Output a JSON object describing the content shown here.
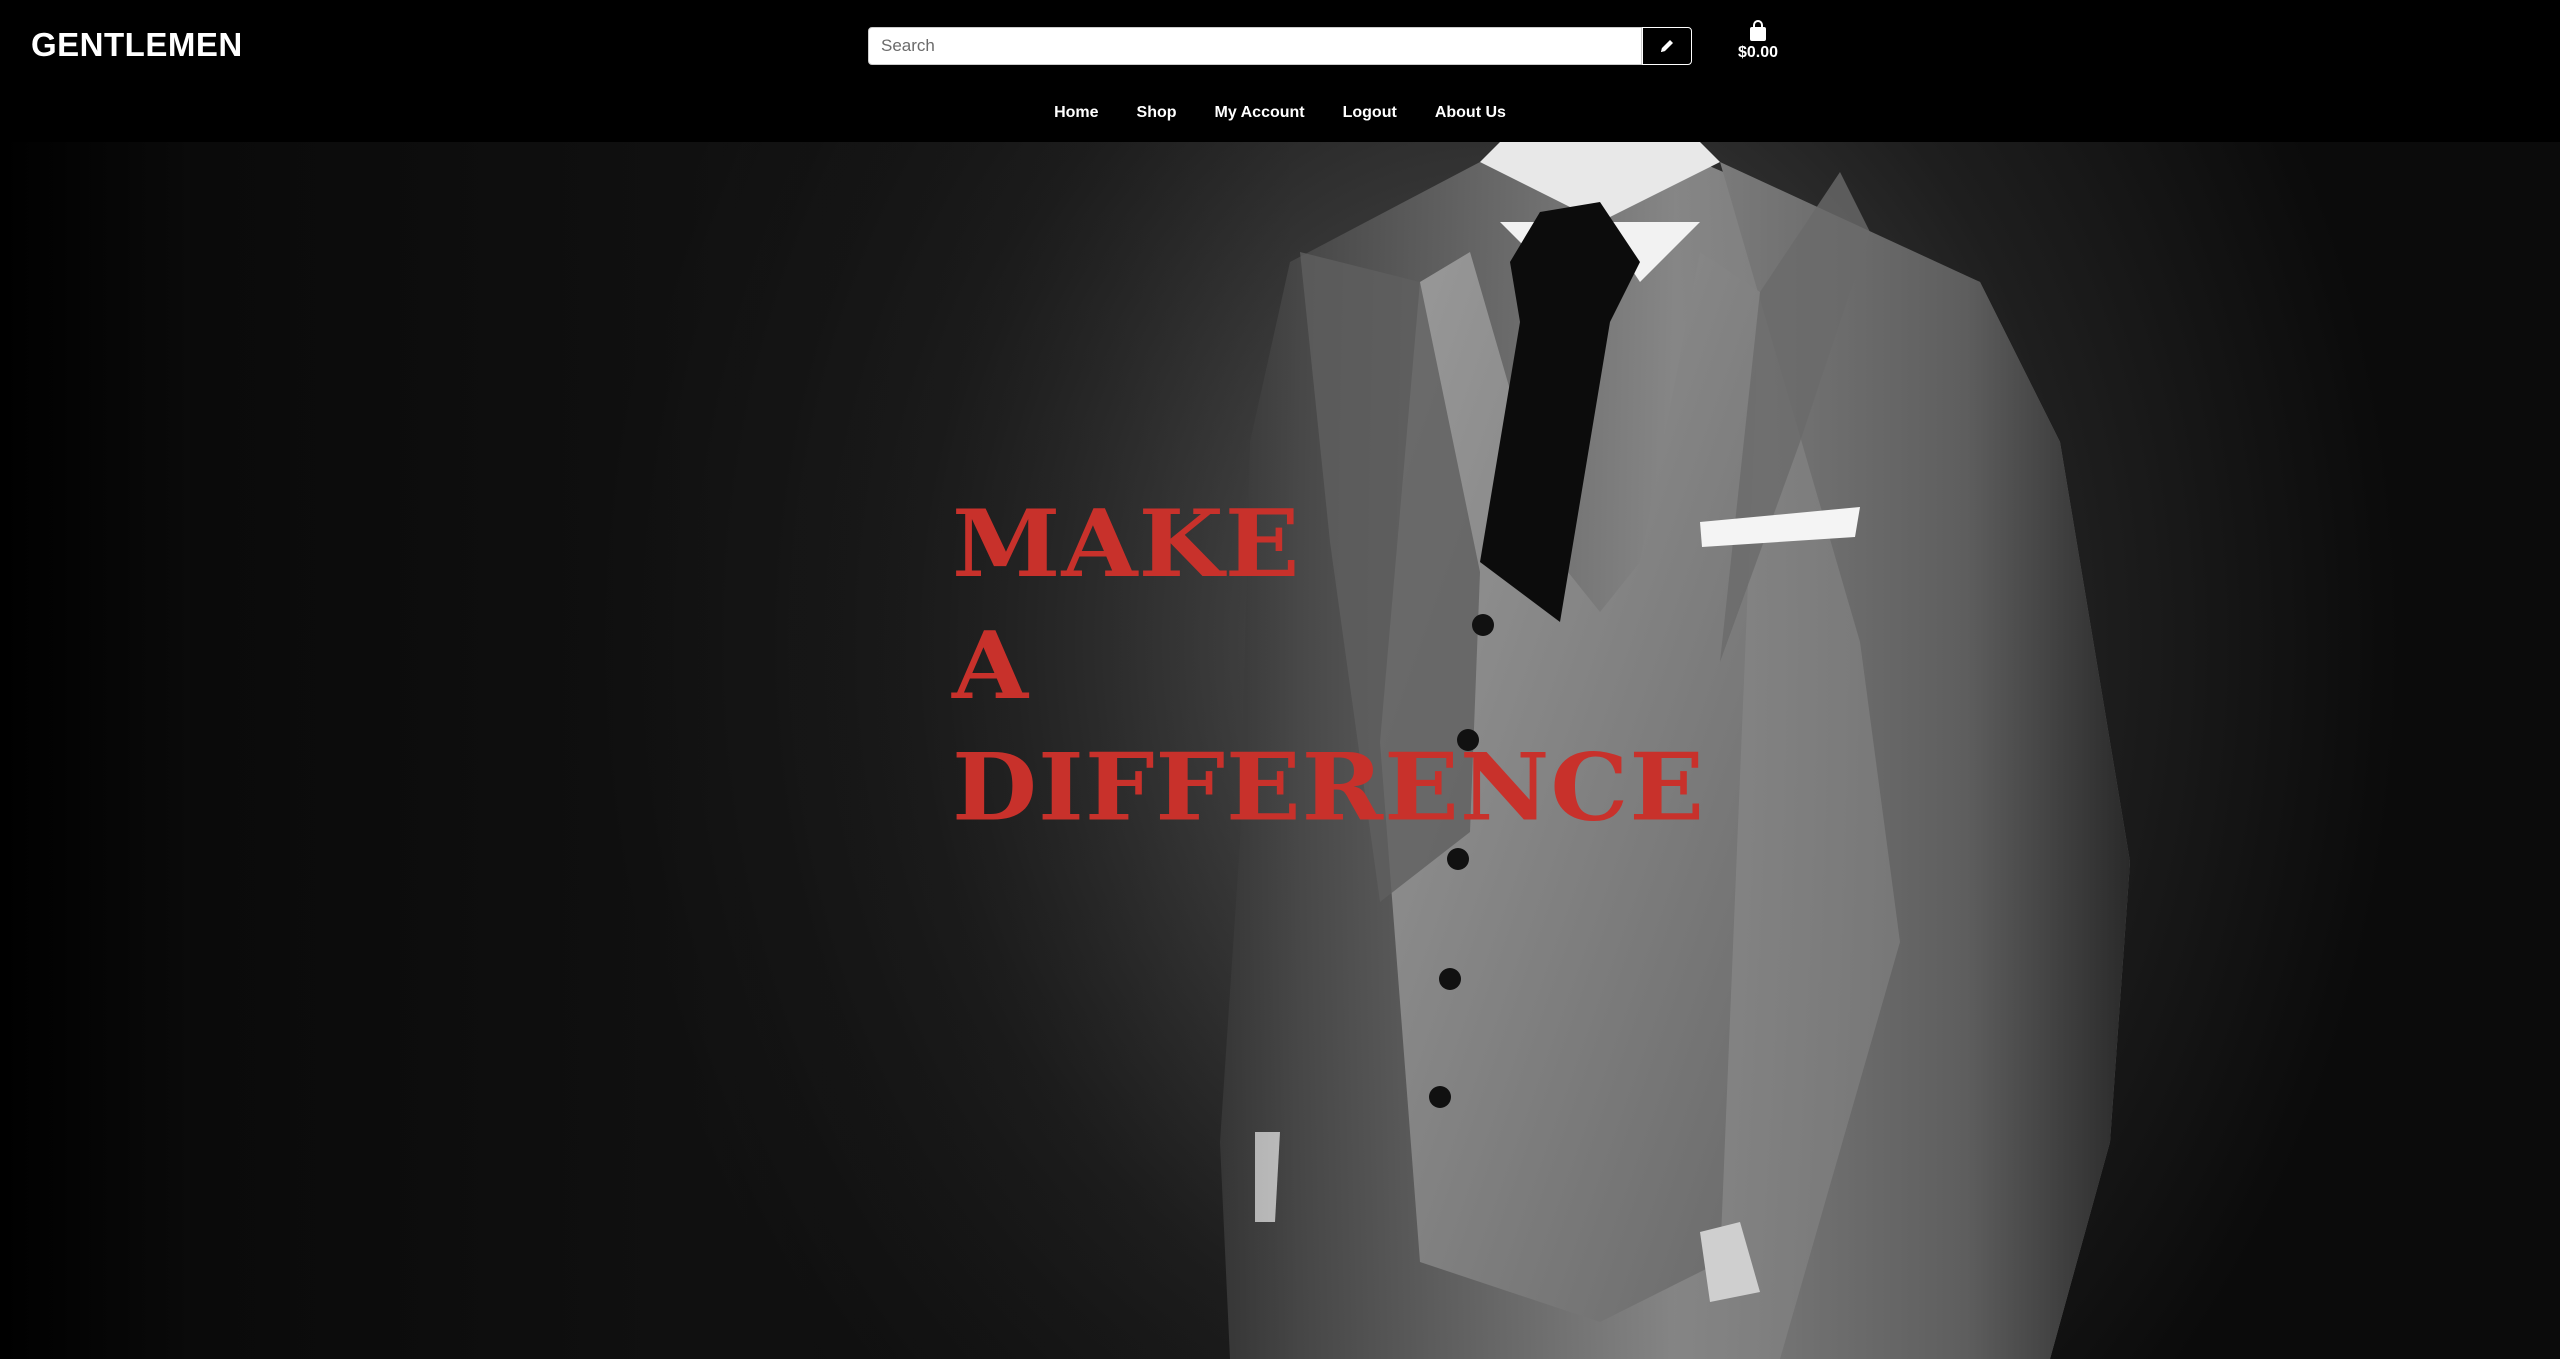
{
  "brand": {
    "name": "GENTLEMEN"
  },
  "search": {
    "placeholder": "Search",
    "value": "",
    "button_icon": "pencil-icon"
  },
  "cart": {
    "icon": "shopping-bag-icon",
    "total": "$0.00"
  },
  "nav": {
    "items": [
      {
        "label": "Home"
      },
      {
        "label": "Shop"
      },
      {
        "label": "My Account"
      },
      {
        "label": "Logout"
      },
      {
        "label": "About Us"
      }
    ]
  },
  "hero": {
    "lines": [
      "MAKE",
      "A",
      "DIFFERENCE"
    ],
    "accent_color": "#c8312b"
  },
  "colors": {
    "header_bg": "#000000",
    "text": "#ffffff"
  }
}
